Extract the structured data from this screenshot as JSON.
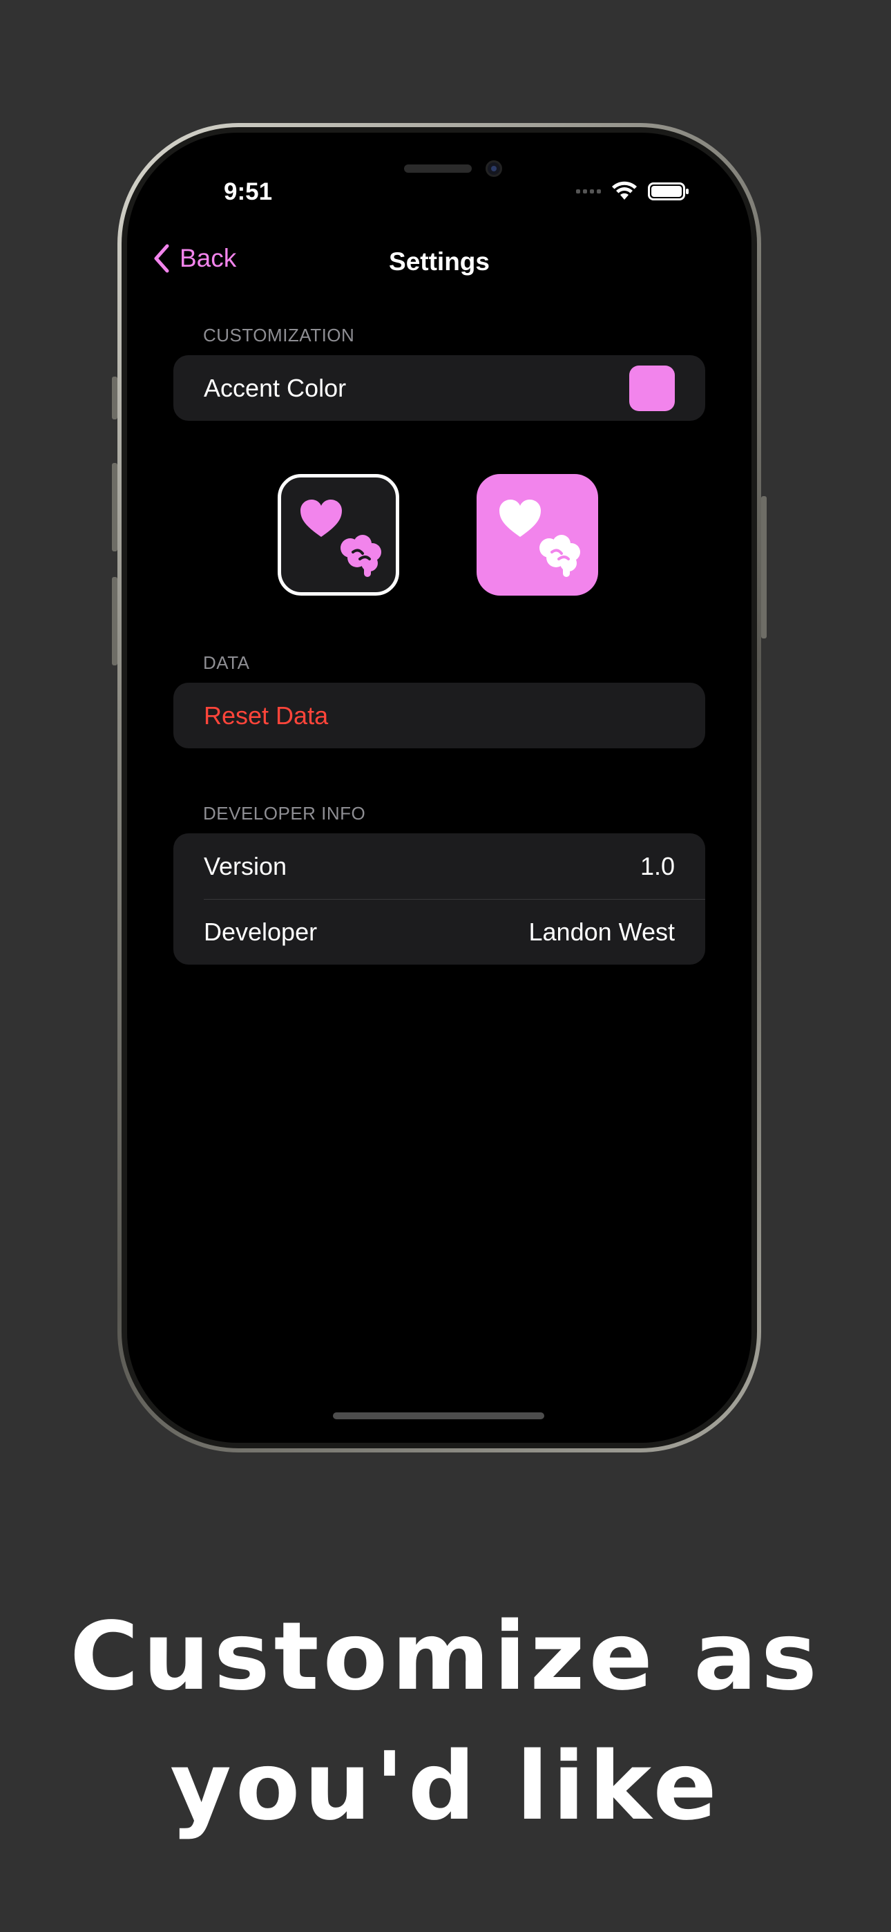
{
  "status_bar": {
    "time": "9:51",
    "icons": [
      "cellular-icon",
      "wifi-icon",
      "battery-icon"
    ]
  },
  "nav": {
    "back_label": "Back",
    "title": "Settings"
  },
  "sections": {
    "customization": {
      "header": "CUSTOMIZATION",
      "accent_label": "Accent Color",
      "accent_color": "#f284ec",
      "app_icons": [
        "app-icon-dark-option",
        "app-icon-pink-option"
      ]
    },
    "data": {
      "header": "DATA",
      "reset_label": "Reset Data"
    },
    "developer": {
      "header": "DEVELOPER INFO",
      "rows": [
        {
          "label": "Version",
          "value": "1.0"
        },
        {
          "label": "Developer",
          "value": "Landon West"
        }
      ]
    }
  },
  "headline": {
    "line1": "Customize as",
    "line2": "you'd like"
  },
  "colors": {
    "background": "#323232",
    "accent": "#f284ec",
    "destructive": "#ff453a",
    "card": "#1c1c1e"
  }
}
